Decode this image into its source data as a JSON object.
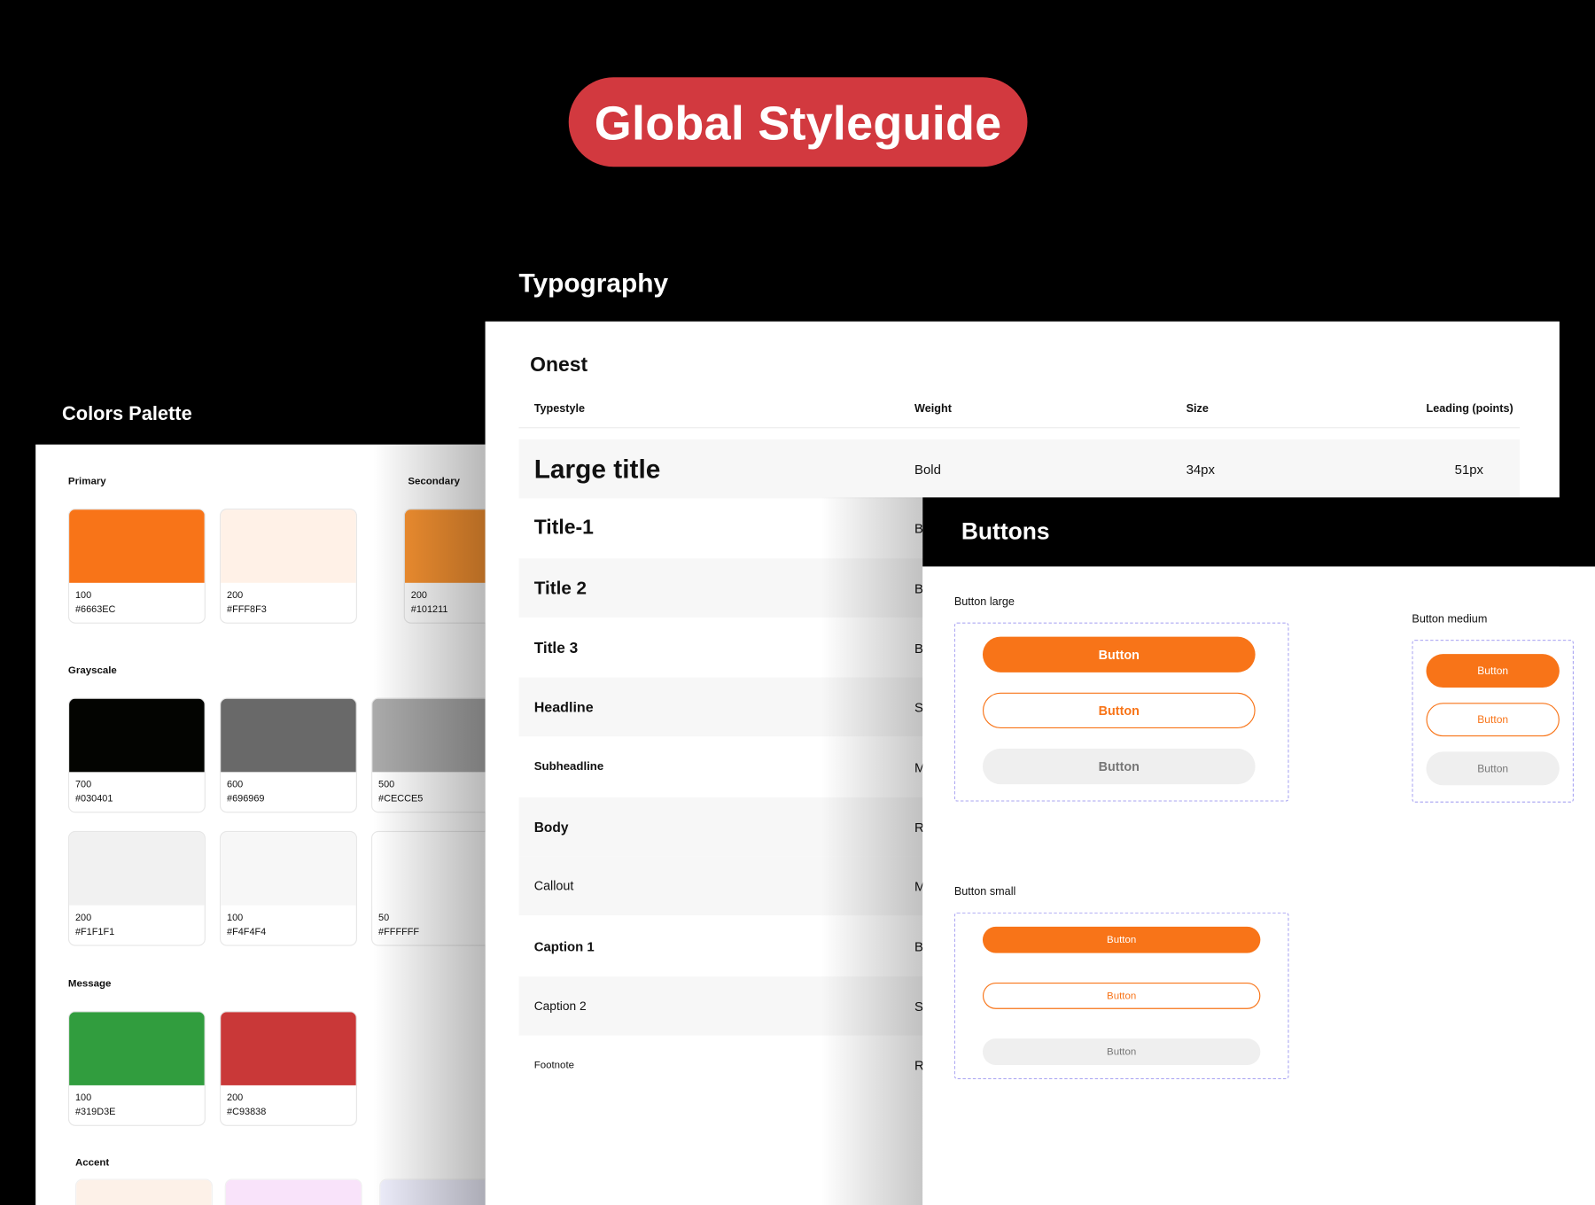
{
  "hero": {
    "title": "Global Styleguide",
    "color": "#D2393F"
  },
  "colors_panel": {
    "title": "Colors Palette",
    "sections": {
      "primary": "Primary",
      "secondary": "Secondary",
      "grayscale": "Grayscale",
      "message": "Message",
      "accent": "Accent"
    },
    "primary": [
      {
        "level": "100",
        "hex": "#6663EC",
        "color": "#F87418"
      },
      {
        "level": "200",
        "hex": "#FFF8F3",
        "color": "#FFF1E7"
      }
    ],
    "secondary": [
      {
        "level": "200",
        "hex": "#101211",
        "color": "#F99432"
      }
    ],
    "grayscale": [
      {
        "level": "700",
        "hex": "#030401",
        "color": "#030401"
      },
      {
        "level": "600",
        "hex": "#696969",
        "color": "#696969"
      },
      {
        "level": "500",
        "hex": "#CECCE5",
        "color": "#AAAAAA"
      },
      {
        "level": "200",
        "hex": "#F1F1F1",
        "color": "#F1F1F1"
      },
      {
        "level": "100",
        "hex": "#F4F4F4",
        "color": "#F7F7F7"
      },
      {
        "level": "50",
        "hex": "#FFFFFF",
        "color": "#FFFFFF"
      }
    ],
    "message": [
      {
        "level": "100",
        "hex": "#319D3E",
        "color": "#319D3E"
      },
      {
        "level": "200",
        "hex": "#C93838",
        "color": "#C93838"
      }
    ],
    "accent_colors": [
      "#FDF1E8",
      "#F9E3FA",
      "#EEEEFC"
    ]
  },
  "typography_panel": {
    "title": "Typography",
    "font_name": "Onest",
    "headers": {
      "typestyle": "Typestyle",
      "weight": "Weight",
      "size": "Size",
      "leading": "Leading (points)"
    },
    "rows": [
      {
        "name": "Large title",
        "weight": "Bold",
        "size": "34px",
        "leading": "51px"
      },
      {
        "name": "Title-1",
        "weight": "B"
      },
      {
        "name": "Title 2",
        "weight": "B"
      },
      {
        "name": "Title 3",
        "weight": "B"
      },
      {
        "name": "Headline",
        "weight": "S"
      },
      {
        "name": "Subheadline",
        "weight": "M"
      },
      {
        "name": "Body",
        "weight": "R"
      },
      {
        "name": "Callout",
        "weight": "M"
      },
      {
        "name": "Caption 1",
        "weight": "B"
      },
      {
        "name": "Caption 2",
        "weight": "S"
      },
      {
        "name": "Footnote",
        "weight": "R"
      }
    ]
  },
  "buttons_panel": {
    "title": "Buttons",
    "large_label": "Button large",
    "medium_label": "Button medium",
    "small_label": "Button small",
    "button_text": "Button",
    "accent": "#F87418"
  }
}
